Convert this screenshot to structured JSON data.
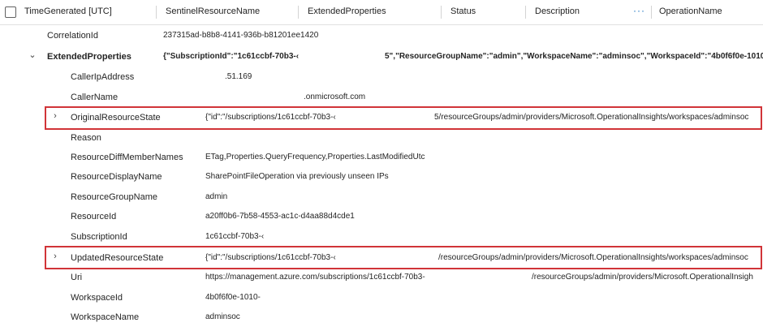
{
  "header": {
    "col_time": "TimeGenerated [UTC]",
    "col_sentinel": "SentinelResourceName",
    "col_extended": "ExtendedProperties",
    "col_status": "Status",
    "col_description": "Description",
    "more": "···",
    "col_operation": "OperationName"
  },
  "top_fields": {
    "correlation_label": "CorrelationId",
    "correlation_value": "237315ad-b8b8-4141-936b-b81201ee1420",
    "extended_label": "ExtendedProperties",
    "extended_value_left": "{\"SubscriptionId\":\"1c61ccbf-70b3-‹",
    "extended_value_right": "5\",\"ResourceGroupName\":\"admin\",\"WorkspaceName\":\"adminsoc\",\"WorkspaceId\":\"4b0f6f0e-1010-‹"
  },
  "fields": {
    "caller_ip_label": "CallerIpAddress",
    "caller_ip_value": ".51.169",
    "caller_name_label": "CallerName",
    "caller_name_value": ".onmicrosoft.com",
    "orig_state_label": "OriginalResourceState",
    "orig_state_left": "{\"id\":\"/subscriptions/1c61ccbf-70b3-‹",
    "orig_state_right": "5/resourceGroups/admin/providers/Microsoft.OperationalInsights/workspaces/adminsoc",
    "reason_label": "Reason",
    "diff_label": "ResourceDiffMemberNames",
    "diff_value": "ETag,Properties.QueryFrequency,Properties.LastModifiedUtc",
    "display_label": "ResourceDisplayName",
    "display_value": "SharePointFileOperation via previously unseen IPs",
    "group_label": "ResourceGroupName",
    "group_value": "admin",
    "resource_id_label": "ResourceId",
    "resource_id_value": "a20ff0b6-7b58-4553-ac1c-d4aa88d4cde1",
    "subscription_label": "SubscriptionId",
    "subscription_value": "1c61ccbf-70b3-‹",
    "updated_state_label": "UpdatedResourceState",
    "updated_state_left": "{\"id\":\"/subscriptions/1c61ccbf-70b3-‹",
    "updated_state_right": "/resourceGroups/admin/providers/Microsoft.OperationalInsights/workspaces/adminsoc",
    "uri_label": "Uri",
    "uri_left": "https://management.azure.com/subscriptions/1c61ccbf-70b3-",
    "uri_right": "/resourceGroups/admin/providers/Microsoft.OperationalInsigh",
    "workspace_id_label": "WorkspaceId",
    "workspace_id_value": "4b0f6f0e-1010-",
    "workspace_name_label": "WorkspaceName",
    "workspace_name_value": "adminsoc"
  },
  "colors": {
    "highlight": "#d13438",
    "link": "#0f6cbd"
  },
  "icons": {
    "expand_open": "chevron-down-icon",
    "expand_closed": "chevron-right-icon"
  }
}
